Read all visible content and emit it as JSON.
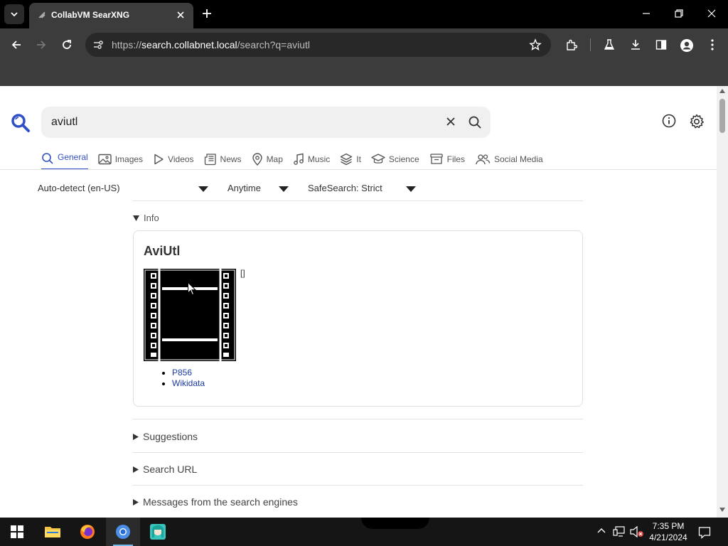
{
  "browser": {
    "tab_title": "CollabVM SearXNG",
    "url_scheme": "https://",
    "url_host": "search.collabnet.local",
    "url_path": "/search?q=aviutl"
  },
  "search": {
    "query": "aviutl"
  },
  "categories": [
    {
      "label": "General",
      "icon": "search-icon",
      "active": true
    },
    {
      "label": "Images",
      "icon": "image-icon",
      "active": false
    },
    {
      "label": "Videos",
      "icon": "play-icon",
      "active": false
    },
    {
      "label": "News",
      "icon": "newspaper-icon",
      "active": false
    },
    {
      "label": "Map",
      "icon": "map-pin-icon",
      "active": false
    },
    {
      "label": "Music",
      "icon": "music-note-icon",
      "active": false
    },
    {
      "label": "It",
      "icon": "layers-icon",
      "active": false
    },
    {
      "label": "Science",
      "icon": "graduation-cap-icon",
      "active": false
    },
    {
      "label": "Files",
      "icon": "archive-icon",
      "active": false
    },
    {
      "label": "Social Media",
      "icon": "people-icon",
      "active": false
    }
  ],
  "filters": {
    "language": "Auto-detect (en-US)",
    "time": "Anytime",
    "safesearch": "SafeSearch: Strict"
  },
  "infobox": {
    "toggle_label": "Info",
    "title": "AviUtl",
    "bracket": "[]",
    "links": [
      "P856",
      "Wikidata"
    ]
  },
  "sections": {
    "suggestions": "Suggestions",
    "search_url": "Search URL",
    "messages": "Messages from the search engines"
  },
  "taskbar": {
    "time": "7:35 PM",
    "date": "4/21/2024"
  },
  "colors": {
    "accent": "#3050c8",
    "link": "#1a3aa0",
    "chrome_dark": "#3c3c3c"
  }
}
